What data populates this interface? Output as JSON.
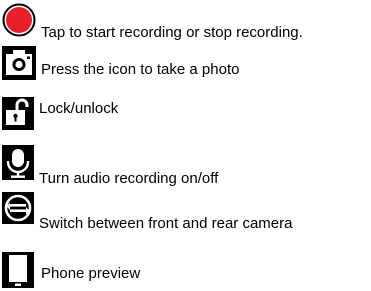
{
  "legend": {
    "items": [
      {
        "icon": "record-icon",
        "text": "Tap to start recording or stop recording."
      },
      {
        "icon": "camera-icon",
        "text": "Press the icon to take a photo"
      },
      {
        "icon": "lock-icon",
        "text": "Lock/unlock"
      },
      {
        "icon": "microphone-icon",
        "text": "Turn audio recording on/off"
      },
      {
        "icon": "switch-camera-icon",
        "text": "Switch between front and rear camera"
      },
      {
        "icon": "phone-icon",
        "text": "Phone preview"
      }
    ]
  },
  "colors": {
    "record_fill": "#e8202a",
    "ink": "#000000",
    "background": "#ffffff"
  }
}
